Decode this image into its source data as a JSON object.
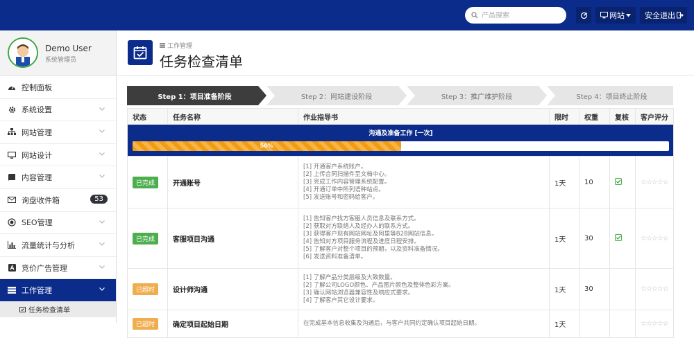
{
  "header": {
    "search_placeholder": "产品搜索",
    "site_label": "网站",
    "logout_label": "安全退出"
  },
  "user": {
    "name": "Demo User",
    "role": "系统管理员"
  },
  "sidebar": {
    "items": [
      {
        "label": "控制面板",
        "icon": "dashboard-icon"
      },
      {
        "label": "系统设置",
        "icon": "gear-icon"
      },
      {
        "label": "网站管理",
        "icon": "sitemap-icon"
      },
      {
        "label": "网站设计",
        "icon": "monitor-icon"
      },
      {
        "label": "内容管理",
        "icon": "book-icon"
      },
      {
        "label": "询盘收件箱",
        "icon": "envelope-icon",
        "badge": "53"
      },
      {
        "label": "SEO管理",
        "icon": "target-icon"
      },
      {
        "label": "流量统计与分析",
        "icon": "bar-chart-icon"
      },
      {
        "label": "竞价广告管理",
        "icon": "ad-icon"
      },
      {
        "label": "工作管理",
        "icon": "tasks-icon"
      }
    ],
    "subitem": "任务检查清单"
  },
  "page": {
    "breadcrumb": "工作管理",
    "title": "任务检查清单"
  },
  "stages": [
    {
      "label": "Step 1：项目准备阶段",
      "active": true
    },
    {
      "label": "Step 2：网站建设阶段",
      "active": false
    },
    {
      "label": "Step 3：推广维护阶段",
      "active": false
    },
    {
      "label": "Step 4：项目终止阶段",
      "active": false
    }
  ],
  "table": {
    "columns": [
      "状态",
      "任务名称",
      "作业指导书",
      "限时",
      "权重",
      "复核",
      "客户评分"
    ],
    "phase": {
      "title": "沟通及准备工作 [一次]",
      "progress": 50,
      "progress_label": "50%"
    },
    "rows": [
      {
        "status": "已完成",
        "status_color": "#4cae4c",
        "name": "开通账号",
        "guide": [
          "[1] 开通客户系统账户。",
          "[2] 上传合同扫描件至文档中心。",
          "[3] 完成工作内容管理系统配置。",
          "[4] 开通订单中所列语种站点。",
          "[5] 发送账号和密码给客户。"
        ],
        "limit": "1天",
        "weight": "10",
        "reviewed": true,
        "stars": "☆☆☆☆☆"
      },
      {
        "status": "已完成",
        "status_color": "#4cae4c",
        "name": "客服项目沟通",
        "guide": [
          "[1] 告知客户找方客服人员信息及联系方式。",
          "[2] 获取对方联络人及经办人的联系方式。",
          "[3] 获得客户现有网站网址及阿里等B2B网站信息。",
          "[4] 告知对方项目服务流程及进度日程安排。",
          "[5] 了解客户对整个项目的预期，以及资料准备情况。",
          "[6] 发送资料准备清单。"
        ],
        "limit": "1天",
        "weight": "30",
        "reviewed": true,
        "stars": "☆☆☆☆☆"
      },
      {
        "status": "已超时",
        "status_color": "#f0ad4e",
        "name": "设计师沟通",
        "guide": [
          "[1] 了解产品分类层级及大致数量。",
          "[2] 了解公司LOGO颜色、产品图片颜色及整体色彩方案。",
          "[3] 确认网站浏览器兼容性及响应式要求。",
          "[4] 了解客户其它设计要求。"
        ],
        "limit": "1天",
        "weight": "30",
        "reviewed": false,
        "stars": "☆☆☆☆☆"
      },
      {
        "status": "已超时",
        "status_color": "#f0ad4e",
        "name": "确定项目起始日期",
        "guide": [
          "在完成基本信息收集及沟通后，与客户共同约定确认项目起始日期。"
        ],
        "limit": "1天",
        "weight": "",
        "reviewed": false,
        "stars": "☆☆☆☆☆"
      }
    ]
  }
}
